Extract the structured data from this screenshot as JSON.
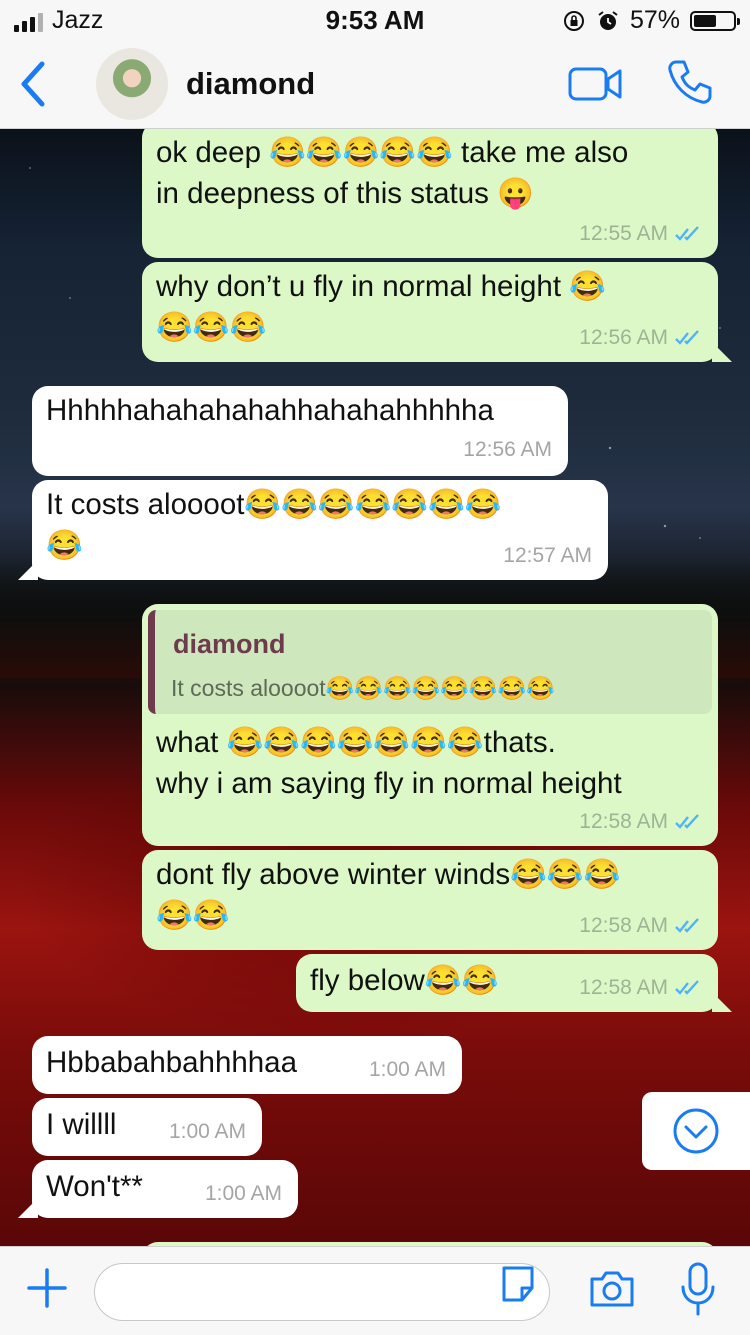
{
  "status_bar": {
    "carrier": "Jazz",
    "time": "9:53 AM",
    "battery": "57%",
    "battery_level": 0.57
  },
  "header": {
    "contact_name": "diamond",
    "back_icon": "chevron-left-icon",
    "video_icon": "video-camera-icon",
    "call_icon": "phone-icon"
  },
  "messages": [
    {
      "dir": "out",
      "lines": [
        "ok deep 😂😂😂😂😂 take me also",
        "in deepness of this status 😛"
      ],
      "time": "12:55 AM",
      "read": true
    },
    {
      "dir": "out",
      "lines": [
        "why don’t u fly in normal height 😂",
        "😂😂😂"
      ],
      "time": "12:56 AM",
      "read": true
    },
    {
      "dir": "in",
      "lines": [
        "Hhhhhahahahahahhahahahhhhha"
      ],
      "time": "12:56 AM"
    },
    {
      "dir": "in",
      "lines": [
        "It costs aloooot😂😂😂😂😂😂😂",
        "😂"
      ],
      "time": "12:57 AM"
    },
    {
      "dir": "out",
      "quote": {
        "name": "diamond",
        "text": "It costs aloooot😂😂😂😂😂😂😂😂"
      },
      "lines": [
        "what 😂😂😂😂😂😂😂thats.",
        "why i am saying fly in normal height"
      ],
      "time": "12:58 AM",
      "read": true
    },
    {
      "dir": "out",
      "lines": [
        "dont fly above winter winds😂😂😂",
        "😂😂"
      ],
      "time": "12:58 AM",
      "read": true
    },
    {
      "dir": "out",
      "lines": [
        "fly below😂😂"
      ],
      "time": "12:58 AM",
      "read": true
    },
    {
      "dir": "in",
      "lines": [
        "Hbbabahbahhhhaa"
      ],
      "time": "1:00 AM"
    },
    {
      "dir": "in",
      "lines": [
        "I willll"
      ],
      "time": "1:00 AM"
    },
    {
      "dir": "in",
      "lines": [
        "Won't**"
      ],
      "time": "1:00 AM"
    }
  ],
  "input": {
    "placeholder": "",
    "plus_icon": "plus-icon",
    "sticker_icon": "sticker-icon",
    "camera_icon": "camera-icon",
    "mic_icon": "microphone-icon"
  },
  "scroll_down_icon": "chevron-down-circle-icon",
  "colors": {
    "accent": "#1a7cf0",
    "outgoing": "#dcf8c6",
    "incoming": "#ffffff",
    "read_tick": "#4fb3f6",
    "quote_name": "#6e3b4e"
  }
}
